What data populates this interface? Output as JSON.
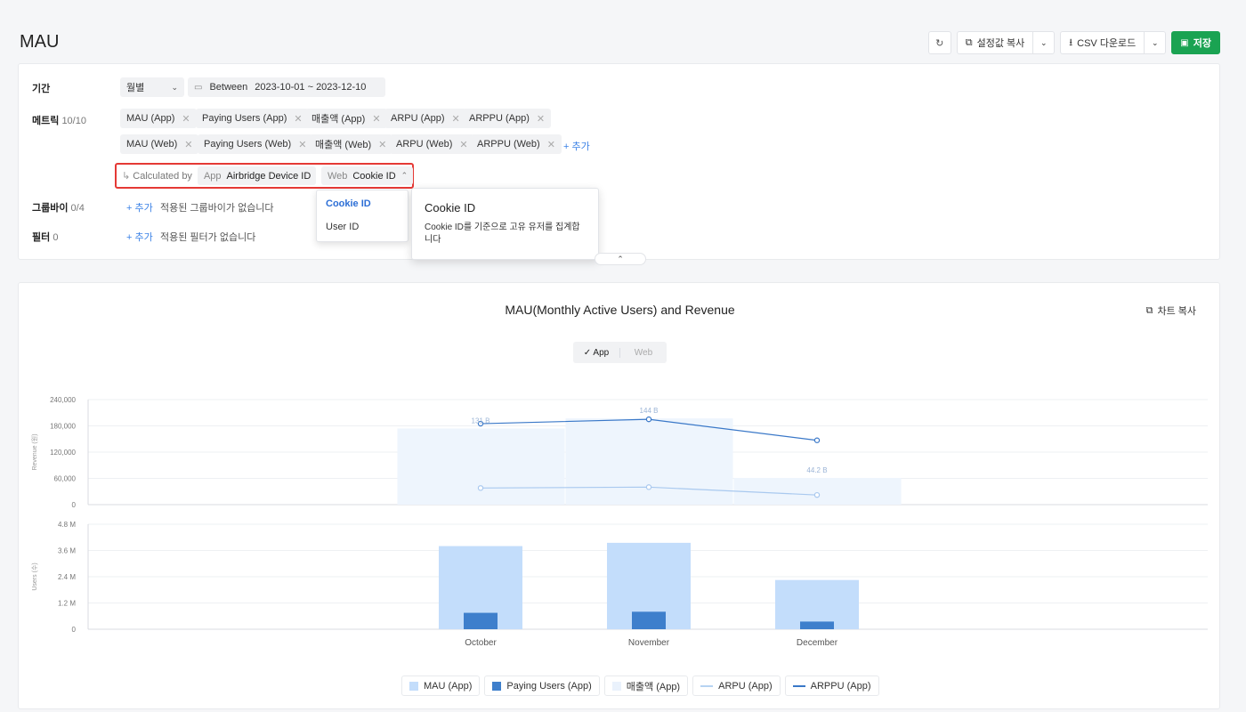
{
  "page": {
    "title": "MAU"
  },
  "toolbar": {
    "copy_settings": "설정값 복사",
    "csv_download": "CSV 다운로드",
    "save": "저장"
  },
  "filters": {
    "period": {
      "label": "기간",
      "granularity": "월별",
      "range_op": "Between",
      "range_value": "2023-10-01 ~ 2023-12-10"
    },
    "metrics": {
      "label": "메트릭",
      "count": "10/10",
      "row1": [
        "MAU (App)",
        "Paying Users (App)",
        "매출액 (App)",
        "ARPU (App)",
        "ARPPU (App)"
      ],
      "row2": [
        "MAU (Web)",
        "Paying Users (Web)",
        "매출액 (Web)",
        "ARPU (Web)",
        "ARPPU (Web)"
      ],
      "add": "+ 추가"
    },
    "calculated_by": {
      "label": "Calculated by",
      "app_key": "App",
      "app_value": "Airbridge Device ID",
      "web_key": "Web",
      "web_value": "Cookie ID"
    },
    "groupby": {
      "label": "그룹바이",
      "count": "0/4",
      "add": "+ 추가",
      "empty": "적용된 그룹바이가 없습니다"
    },
    "filter": {
      "label": "필터",
      "count": "0",
      "add": "+ 추가",
      "empty": "적용된 필터가 없습니다"
    }
  },
  "dropdown": {
    "options": [
      "Cookie ID",
      "User ID"
    ],
    "selected": "Cookie ID"
  },
  "tooltip": {
    "title": "Cookie ID",
    "description": "Cookie ID를 기준으로 고유 유저를 집계합니다"
  },
  "chart": {
    "copy_label": "차트 복사",
    "toggle": {
      "app": "App",
      "web": "Web",
      "active": "App"
    },
    "legend": [
      "MAU (App)",
      "Paying Users (App)",
      "매출액 (App)",
      "ARPU (App)",
      "ARPPU (App)"
    ],
    "colors": {
      "mau": "#c3ddfb",
      "paying": "#3e7fcc",
      "revenue": "#eef5fd",
      "arpu": "#a9c9ef",
      "arppu": "#3a78c8"
    }
  },
  "chart_data": {
    "type": "bar",
    "title": "MAU(Monthly Active Users) and Revenue",
    "categories": [
      "October",
      "November",
      "December"
    ],
    "top_axis": {
      "ylabel": "Revenue (원)",
      "ylim": [
        0,
        240000
      ],
      "ticks": [
        "0",
        "60,000",
        "120,000",
        "180,000",
        "240,000"
      ]
    },
    "bottom_axis": {
      "ylabel": "Users (수)",
      "ylim": [
        0,
        4800000
      ],
      "ticks": [
        "0",
        "1.2 M",
        "2.4 M",
        "3.6 M",
        "4.8 M"
      ]
    },
    "series": [
      {
        "name": "MAU (App)",
        "kind": "bar",
        "axis": "bottom",
        "values": [
          3800000,
          3950000,
          2250000
        ]
      },
      {
        "name": "Paying Users (App)",
        "kind": "bar",
        "axis": "bottom",
        "values": [
          750000,
          800000,
          350000
        ]
      },
      {
        "name": "매출액 (App)",
        "kind": "area-bar",
        "axis": "top",
        "values": [
          174000,
          197000,
          61000
        ],
        "labels": [
          "131 B",
          "144 B",
          "44.2 B"
        ]
      },
      {
        "name": "ARPU (App)",
        "kind": "line",
        "axis": "top",
        "values": [
          38000,
          40000,
          22000
        ]
      },
      {
        "name": "ARPPU (App)",
        "kind": "line",
        "axis": "top",
        "values": [
          185000,
          195000,
          147000
        ]
      }
    ],
    "grid": true,
    "legend_position": "bottom"
  }
}
